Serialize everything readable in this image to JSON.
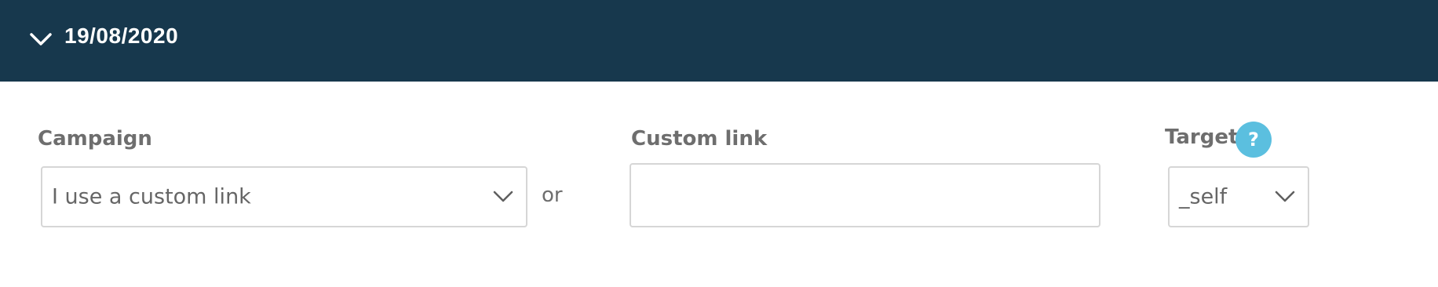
{
  "header": {
    "date": "19/08/2020",
    "toggle_icon": "chevron-down-icon",
    "background_color": "#17384d"
  },
  "campaign": {
    "label": "Campaign",
    "selected": "I use a custom link"
  },
  "separator": {
    "text": "or"
  },
  "custom_link": {
    "label": "Custom link",
    "value": "",
    "placeholder": ""
  },
  "target": {
    "label": "Target",
    "selected": "_self",
    "help_label": "?",
    "help_color": "#5bbfdf"
  }
}
